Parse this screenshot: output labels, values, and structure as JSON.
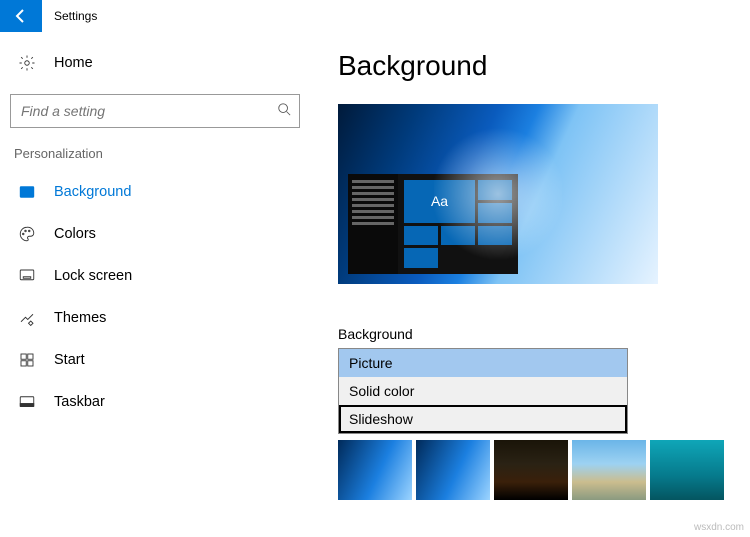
{
  "titlebar": {
    "title": "Settings"
  },
  "sidebar": {
    "home": "Home",
    "search_placeholder": "Find a setting",
    "category": "Personalization",
    "items": [
      {
        "label": "Background"
      },
      {
        "label": "Colors"
      },
      {
        "label": "Lock screen"
      },
      {
        "label": "Themes"
      },
      {
        "label": "Start"
      },
      {
        "label": "Taskbar"
      }
    ]
  },
  "main": {
    "heading": "Background",
    "sample_text": "Aa",
    "dropdown_label": "Background",
    "options": [
      {
        "label": "Picture"
      },
      {
        "label": "Solid color"
      },
      {
        "label": "Slideshow"
      }
    ]
  },
  "watermark": "wsxdn.com"
}
